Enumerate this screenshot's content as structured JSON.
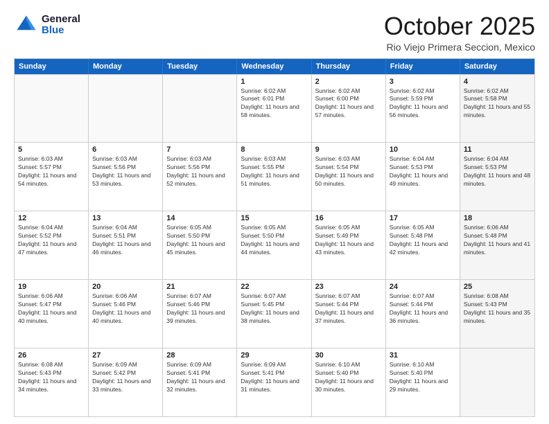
{
  "header": {
    "logo_general": "General",
    "logo_blue": "Blue",
    "month_title": "October 2025",
    "location": "Rio Viejo Primera Seccion, Mexico"
  },
  "calendar": {
    "days_of_week": [
      "Sunday",
      "Monday",
      "Tuesday",
      "Wednesday",
      "Thursday",
      "Friday",
      "Saturday"
    ],
    "rows": [
      [
        {
          "day": "",
          "empty": true
        },
        {
          "day": "",
          "empty": true
        },
        {
          "day": "",
          "empty": true
        },
        {
          "day": "1",
          "sunrise": "Sunrise: 6:02 AM",
          "sunset": "Sunset: 6:01 PM",
          "daylight": "Daylight: 11 hours and 58 minutes."
        },
        {
          "day": "2",
          "sunrise": "Sunrise: 6:02 AM",
          "sunset": "Sunset: 6:00 PM",
          "daylight": "Daylight: 11 hours and 57 minutes."
        },
        {
          "day": "3",
          "sunrise": "Sunrise: 6:02 AM",
          "sunset": "Sunset: 5:59 PM",
          "daylight": "Daylight: 11 hours and 56 minutes."
        },
        {
          "day": "4",
          "sunrise": "Sunrise: 6:02 AM",
          "sunset": "Sunset: 5:58 PM",
          "daylight": "Daylight: 11 hours and 55 minutes.",
          "shaded": true
        }
      ],
      [
        {
          "day": "5",
          "sunrise": "Sunrise: 6:03 AM",
          "sunset": "Sunset: 5:57 PM",
          "daylight": "Daylight: 11 hours and 54 minutes."
        },
        {
          "day": "6",
          "sunrise": "Sunrise: 6:03 AM",
          "sunset": "Sunset: 5:56 PM",
          "daylight": "Daylight: 11 hours and 53 minutes."
        },
        {
          "day": "7",
          "sunrise": "Sunrise: 6:03 AM",
          "sunset": "Sunset: 5:56 PM",
          "daylight": "Daylight: 11 hours and 52 minutes."
        },
        {
          "day": "8",
          "sunrise": "Sunrise: 6:03 AM",
          "sunset": "Sunset: 5:55 PM",
          "daylight": "Daylight: 11 hours and 51 minutes."
        },
        {
          "day": "9",
          "sunrise": "Sunrise: 6:03 AM",
          "sunset": "Sunset: 5:54 PM",
          "daylight": "Daylight: 11 hours and 50 minutes."
        },
        {
          "day": "10",
          "sunrise": "Sunrise: 6:04 AM",
          "sunset": "Sunset: 5:53 PM",
          "daylight": "Daylight: 11 hours and 49 minutes."
        },
        {
          "day": "11",
          "sunrise": "Sunrise: 6:04 AM",
          "sunset": "Sunset: 5:53 PM",
          "daylight": "Daylight: 11 hours and 48 minutes.",
          "shaded": true
        }
      ],
      [
        {
          "day": "12",
          "sunrise": "Sunrise: 6:04 AM",
          "sunset": "Sunset: 5:52 PM",
          "daylight": "Daylight: 11 hours and 47 minutes."
        },
        {
          "day": "13",
          "sunrise": "Sunrise: 6:04 AM",
          "sunset": "Sunset: 5:51 PM",
          "daylight": "Daylight: 11 hours and 46 minutes."
        },
        {
          "day": "14",
          "sunrise": "Sunrise: 6:05 AM",
          "sunset": "Sunset: 5:50 PM",
          "daylight": "Daylight: 11 hours and 45 minutes."
        },
        {
          "day": "15",
          "sunrise": "Sunrise: 6:05 AM",
          "sunset": "Sunset: 5:50 PM",
          "daylight": "Daylight: 11 hours and 44 minutes."
        },
        {
          "day": "16",
          "sunrise": "Sunrise: 6:05 AM",
          "sunset": "Sunset: 5:49 PM",
          "daylight": "Daylight: 11 hours and 43 minutes."
        },
        {
          "day": "17",
          "sunrise": "Sunrise: 6:05 AM",
          "sunset": "Sunset: 5:48 PM",
          "daylight": "Daylight: 11 hours and 42 minutes."
        },
        {
          "day": "18",
          "sunrise": "Sunrise: 6:06 AM",
          "sunset": "Sunset: 5:48 PM",
          "daylight": "Daylight: 11 hours and 41 minutes.",
          "shaded": true
        }
      ],
      [
        {
          "day": "19",
          "sunrise": "Sunrise: 6:06 AM",
          "sunset": "Sunset: 5:47 PM",
          "daylight": "Daylight: 11 hours and 40 minutes."
        },
        {
          "day": "20",
          "sunrise": "Sunrise: 6:06 AM",
          "sunset": "Sunset: 5:46 PM",
          "daylight": "Daylight: 11 hours and 40 minutes."
        },
        {
          "day": "21",
          "sunrise": "Sunrise: 6:07 AM",
          "sunset": "Sunset: 5:46 PM",
          "daylight": "Daylight: 11 hours and 39 minutes."
        },
        {
          "day": "22",
          "sunrise": "Sunrise: 6:07 AM",
          "sunset": "Sunset: 5:45 PM",
          "daylight": "Daylight: 11 hours and 38 minutes."
        },
        {
          "day": "23",
          "sunrise": "Sunrise: 6:07 AM",
          "sunset": "Sunset: 5:44 PM",
          "daylight": "Daylight: 11 hours and 37 minutes."
        },
        {
          "day": "24",
          "sunrise": "Sunrise: 6:07 AM",
          "sunset": "Sunset: 5:44 PM",
          "daylight": "Daylight: 11 hours and 36 minutes."
        },
        {
          "day": "25",
          "sunrise": "Sunrise: 6:08 AM",
          "sunset": "Sunset: 5:43 PM",
          "daylight": "Daylight: 11 hours and 35 minutes.",
          "shaded": true
        }
      ],
      [
        {
          "day": "26",
          "sunrise": "Sunrise: 6:08 AM",
          "sunset": "Sunset: 5:43 PM",
          "daylight": "Daylight: 11 hours and 34 minutes."
        },
        {
          "day": "27",
          "sunrise": "Sunrise: 6:09 AM",
          "sunset": "Sunset: 5:42 PM",
          "daylight": "Daylight: 11 hours and 33 minutes."
        },
        {
          "day": "28",
          "sunrise": "Sunrise: 6:09 AM",
          "sunset": "Sunset: 5:41 PM",
          "daylight": "Daylight: 11 hours and 32 minutes."
        },
        {
          "day": "29",
          "sunrise": "Sunrise: 6:09 AM",
          "sunset": "Sunset: 5:41 PM",
          "daylight": "Daylight: 11 hours and 31 minutes."
        },
        {
          "day": "30",
          "sunrise": "Sunrise: 6:10 AM",
          "sunset": "Sunset: 5:40 PM",
          "daylight": "Daylight: 11 hours and 30 minutes."
        },
        {
          "day": "31",
          "sunrise": "Sunrise: 6:10 AM",
          "sunset": "Sunset: 5:40 PM",
          "daylight": "Daylight: 11 hours and 29 minutes."
        },
        {
          "day": "",
          "empty": true,
          "shaded": true
        }
      ]
    ]
  }
}
